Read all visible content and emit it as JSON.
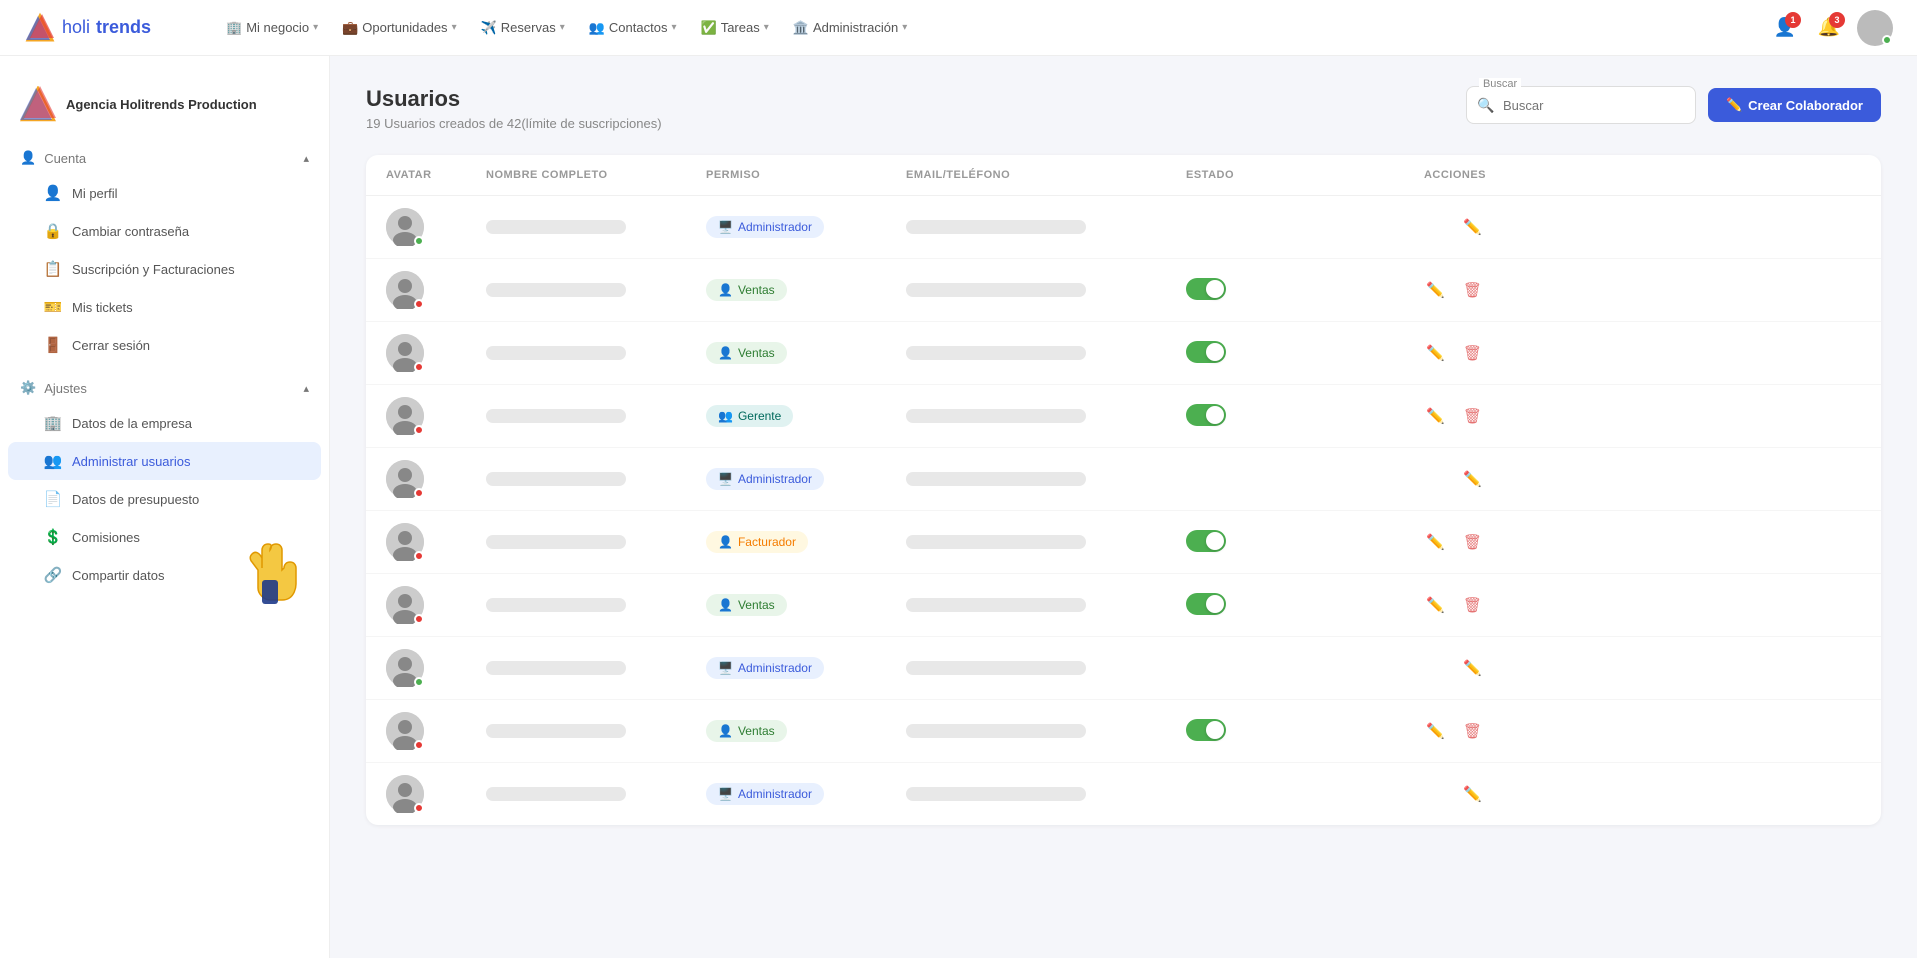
{
  "topnav": {
    "logo_text": "holi",
    "logo_bold": "trends",
    "nav_items": [
      {
        "icon": "🏢",
        "label": "Mi negocio",
        "has_chevron": true
      },
      {
        "icon": "💼",
        "label": "Oportunidades",
        "has_chevron": true
      },
      {
        "icon": "✈️",
        "label": "Reservas",
        "has_chevron": true
      },
      {
        "icon": "👥",
        "label": "Contactos",
        "has_chevron": true
      },
      {
        "icon": "✅",
        "label": "Tareas",
        "has_chevron": true
      },
      {
        "icon": "🏛️",
        "label": "Administración",
        "has_chevron": true
      }
    ],
    "notif1_count": "1",
    "notif2_count": "3"
  },
  "sidebar": {
    "agency_name": "Agencia Holitrends Production",
    "sections": [
      {
        "title": "Cuenta",
        "icon": "👤",
        "expanded": true,
        "items": [
          {
            "id": "mi-perfil",
            "icon": "👤",
            "label": "Mi perfil",
            "active": false
          },
          {
            "id": "cambiar-contrasena",
            "icon": "🔒",
            "label": "Cambiar contraseña",
            "active": false
          },
          {
            "id": "suscripcion",
            "icon": "📋",
            "label": "Suscripción y Facturaciones",
            "active": false
          },
          {
            "id": "mis-tickets",
            "icon": "🎫",
            "label": "Mis tickets",
            "active": false
          },
          {
            "id": "cerrar-sesion",
            "icon": "🚪",
            "label": "Cerrar sesión",
            "active": false
          }
        ]
      },
      {
        "title": "Ajustes",
        "icon": "⚙️",
        "expanded": true,
        "items": [
          {
            "id": "datos-empresa",
            "icon": "🏢",
            "label": "Datos de la empresa",
            "active": false
          },
          {
            "id": "administrar-usuarios",
            "icon": "👥",
            "label": "Administrar usuarios",
            "active": true
          },
          {
            "id": "datos-presupuesto",
            "icon": "📄",
            "label": "Datos de presupuesto",
            "active": false
          },
          {
            "id": "comisiones",
            "icon": "💲",
            "label": "Comisiones",
            "active": false
          },
          {
            "id": "compartir-datos",
            "icon": "🔗",
            "label": "Compartir datos",
            "active": false
          }
        ]
      }
    ]
  },
  "page": {
    "title": "Usuarios",
    "subtitle": "19 Usuarios creados de 42(límite de suscripciones)",
    "search_placeholder": "Buscar",
    "search_label": "Buscar",
    "create_button": "Crear Colaborador"
  },
  "table": {
    "columns": [
      "AVATAR",
      "NOMBRE COMPLETO",
      "PERMISO",
      "EMAIL/TELÉFONO",
      "ESTADO",
      "ACCIONES"
    ],
    "rows": [
      {
        "avatar_dot": "green",
        "permission": "Administrador",
        "permission_type": "admin",
        "has_toggle": false,
        "toggle_on": false
      },
      {
        "avatar_dot": "red",
        "permission": "Ventas",
        "permission_type": "ventas",
        "has_toggle": true,
        "toggle_on": true
      },
      {
        "avatar_dot": "red",
        "permission": "Ventas",
        "permission_type": "ventas",
        "has_toggle": true,
        "toggle_on": true
      },
      {
        "avatar_dot": "red",
        "permission": "Gerente",
        "permission_type": "gerente",
        "has_toggle": true,
        "toggle_on": true
      },
      {
        "avatar_dot": "red",
        "permission": "Administrador",
        "permission_type": "admin",
        "has_toggle": false,
        "toggle_on": false
      },
      {
        "avatar_dot": "red",
        "permission": "Facturador",
        "permission_type": "facturador",
        "has_toggle": true,
        "toggle_on": true
      },
      {
        "avatar_dot": "red",
        "permission": "Ventas",
        "permission_type": "ventas",
        "has_toggle": true,
        "toggle_on": true
      },
      {
        "avatar_dot": "green",
        "permission": "Administrador",
        "permission_type": "admin",
        "has_toggle": false,
        "toggle_on": false
      },
      {
        "avatar_dot": "red",
        "permission": "Ventas",
        "permission_type": "ventas",
        "has_toggle": true,
        "toggle_on": true
      },
      {
        "avatar_dot": "red",
        "permission": "Administrador",
        "permission_type": "admin",
        "has_toggle": false,
        "toggle_on": false
      }
    ]
  }
}
